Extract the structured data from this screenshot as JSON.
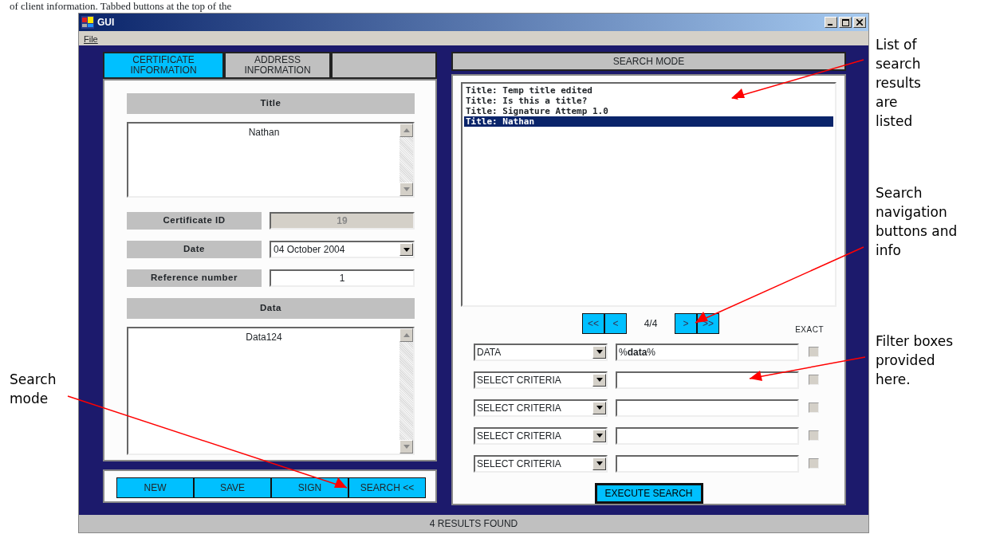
{
  "caption_fragment": "of client information. Tabbed buttons at the top of the",
  "window": {
    "title": "GUI",
    "menu": [
      "File"
    ]
  },
  "tabs": [
    {
      "label": "CERTIFICATE INFORMATION",
      "selected": true
    },
    {
      "label": "ADDRESS INFORMATION",
      "selected": false
    }
  ],
  "form": {
    "title_label": "Title",
    "title_value": "Nathan",
    "certificate_id_label": "Certificate ID",
    "certificate_id_value": "19",
    "certificate_id_disabled": true,
    "date_label": "Date",
    "date_value": "04  October  2004",
    "reference_label": "Reference number",
    "reference_value": "1",
    "data_label": "Data",
    "data_value": "Data124"
  },
  "actions": [
    "NEW",
    "SAVE",
    "SIGN",
    "SEARCH <<"
  ],
  "search": {
    "header": "SEARCH MODE",
    "results": [
      {
        "text": "Title: Temp title edited",
        "selected": false
      },
      {
        "text": "Title: Is this a title?",
        "selected": false
      },
      {
        "text": "Title: Signature Attemp 1.0",
        "selected": false
      },
      {
        "text": "Title: Nathan",
        "selected": true
      }
    ],
    "nav_first": "<<",
    "nav_prev": "<",
    "position": "4/4",
    "nav_next": ">",
    "nav_last": ">>",
    "exact_label": "EXACT",
    "filters": [
      {
        "criteria": "DATA",
        "value": "%**data**%",
        "exact": false
      },
      {
        "criteria": "SELECT CRITERIA",
        "exact": false
      },
      {
        "criteria": "SELECT CRITERIA",
        "exact": false
      },
      {
        "criteria": "SELECT CRITERIA",
        "exact": false
      },
      {
        "criteria": "SELECT CRITERIA",
        "exact": false
      }
    ],
    "execute": "EXECUTE SEARCH"
  },
  "status_bar": "4 RESULTS FOUND",
  "annotations": [
    {
      "text": "List of search results are listed"
    },
    {
      "text": "Search navigation buttons and info"
    },
    {
      "text": "Filter boxes provided here."
    },
    {
      "text": "Search mode"
    }
  ]
}
